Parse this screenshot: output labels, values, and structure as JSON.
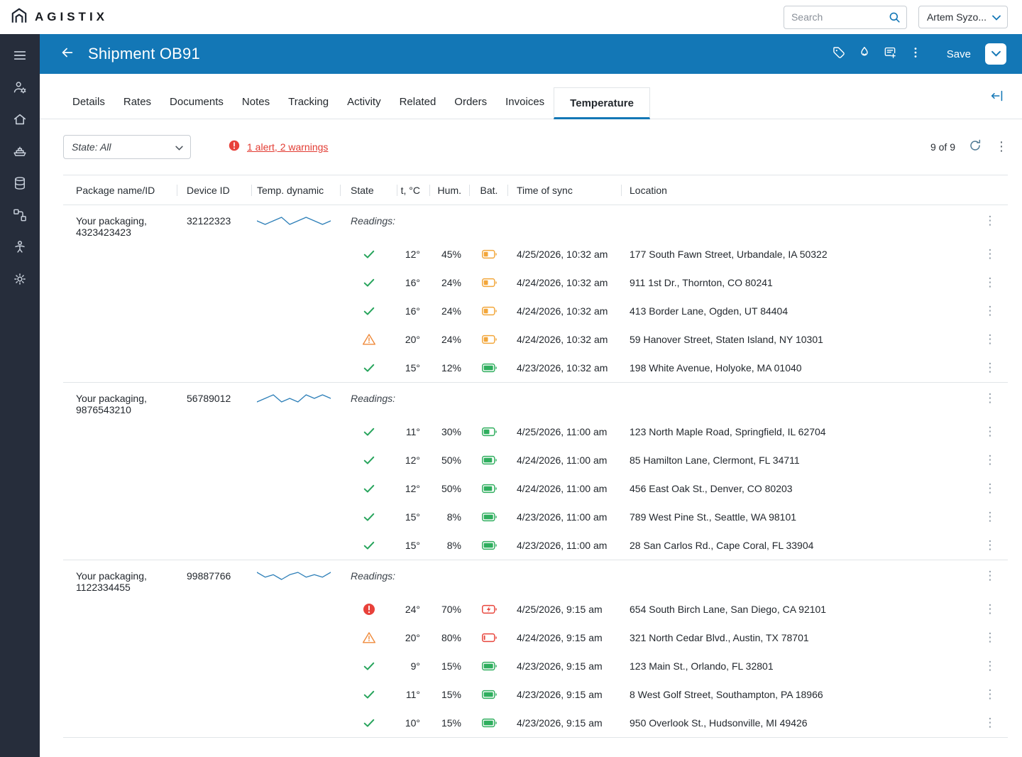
{
  "brand": {
    "name": "AGISTIX"
  },
  "topbar": {
    "search_placeholder": "Search",
    "user_menu_label": "Artem Syzo..."
  },
  "sidebar": {
    "items": [
      {
        "id": "menu"
      },
      {
        "id": "user-settings"
      },
      {
        "id": "home"
      },
      {
        "id": "ship"
      },
      {
        "id": "database"
      },
      {
        "id": "workflow"
      },
      {
        "id": "person"
      },
      {
        "id": "gear"
      }
    ]
  },
  "header": {
    "title": "Shipment OB91",
    "save_label": "Save",
    "actions": [
      {
        "id": "tag"
      },
      {
        "id": "flame"
      },
      {
        "id": "note-add"
      },
      {
        "id": "more"
      }
    ]
  },
  "tabs": [
    {
      "label": "Details"
    },
    {
      "label": "Rates"
    },
    {
      "label": "Documents"
    },
    {
      "label": "Notes"
    },
    {
      "label": "Tracking"
    },
    {
      "label": "Activity"
    },
    {
      "label": "Related"
    },
    {
      "label": "Orders"
    },
    {
      "label": "Invoices"
    },
    {
      "label": "Temperature",
      "active": true
    }
  ],
  "filterbar": {
    "state_filter": "State: All",
    "alerts_link": "1 alert, 2 warnings",
    "counter": "9 of 9"
  },
  "table": {
    "columns": [
      "Package name/ID",
      "Device ID",
      "Temp. dynamic",
      "State",
      "t, °C",
      "Hum.",
      "Bat.",
      "Time of sync",
      "Location"
    ],
    "readings_label": "Readings:",
    "groups": [
      {
        "package_name": "Your packaging,",
        "package_id": "4323423423",
        "device_id": "32122323",
        "sparkline": [
          6,
          5,
          6,
          7,
          5,
          6,
          7,
          6,
          5,
          6
        ],
        "readings": [
          {
            "state": "ok",
            "temp": "12°",
            "humidity": "45%",
            "battery": {
              "color": "yellow",
              "level": 0.45,
              "charging": false
            },
            "time": "4/25/2026, 10:32 am",
            "location": "177 South Fawn Street, Urbandale, IA 50322"
          },
          {
            "state": "ok",
            "temp": "16°",
            "humidity": "24%",
            "battery": {
              "color": "yellow",
              "level": 0.45,
              "charging": false
            },
            "time": "4/24/2026, 10:32 am",
            "location": "911 1st Dr., Thornton, CO 80241"
          },
          {
            "state": "ok",
            "temp": "16°",
            "humidity": "24%",
            "battery": {
              "color": "yellow",
              "level": 0.45,
              "charging": false
            },
            "time": "4/24/2026, 10:32 am",
            "location": "413 Border Lane, Ogden, UT 84404"
          },
          {
            "state": "warning",
            "temp": "20°",
            "humidity": "24%",
            "battery": {
              "color": "yellow",
              "level": 0.45,
              "charging": false
            },
            "time": "4/24/2026, 10:32 am",
            "location": "59 Hanover Street, Staten Island, NY 10301"
          },
          {
            "state": "ok",
            "temp": "15°",
            "humidity": "12%",
            "battery": {
              "color": "green",
              "level": 1,
              "charging": false
            },
            "time": "4/23/2026, 10:32 am",
            "location": "198 White Avenue, Holyoke, MA 01040"
          }
        ]
      },
      {
        "package_name": "Your packaging,",
        "package_id": "9876543210",
        "device_id": "56789012",
        "sparkline": [
          5,
          6,
          7,
          5,
          6,
          5,
          7,
          6,
          7,
          6
        ],
        "readings": [
          {
            "state": "ok",
            "temp": "11°",
            "humidity": "30%",
            "battery": {
              "color": "green",
              "level": 0.6,
              "charging": false
            },
            "time": "4/25/2026, 11:00 am",
            "location": "123 North Maple Road, Springfield, IL 62704"
          },
          {
            "state": "ok",
            "temp": "12°",
            "humidity": "50%",
            "battery": {
              "color": "green",
              "level": 0.9,
              "charging": false
            },
            "time": "4/24/2026, 11:00 am",
            "location": "85 Hamilton Lane, Clermont, FL 34711"
          },
          {
            "state": "ok",
            "temp": "12°",
            "humidity": "50%",
            "battery": {
              "color": "green",
              "level": 0.9,
              "charging": false
            },
            "time": "4/24/2026, 11:00 am",
            "location": "456 East Oak St., Denver, CO 80203"
          },
          {
            "state": "ok",
            "temp": "15°",
            "humidity": "8%",
            "battery": {
              "color": "green",
              "level": 1,
              "charging": false
            },
            "time": "4/23/2026, 11:00 am",
            "location": "789 West Pine St., Seattle, WA 98101"
          },
          {
            "state": "ok",
            "temp": "15°",
            "humidity": "8%",
            "battery": {
              "color": "green",
              "level": 1,
              "charging": false
            },
            "time": "4/23/2026, 11:00 am",
            "location": "28 San Carlos Rd., Cape Coral, FL 33904"
          }
        ]
      },
      {
        "package_name": "Your packaging,",
        "package_id": "1122334455",
        "device_id": "99887766",
        "sparkline": [
          7,
          5,
          6,
          4,
          6,
          7,
          5,
          6,
          5,
          7
        ],
        "readings": [
          {
            "state": "alert",
            "temp": "24°",
            "humidity": "70%",
            "battery": {
              "color": "red",
              "level": 0,
              "charging": true
            },
            "time": "4/25/2026, 9:15 am",
            "location": "654 South Birch Lane, San Diego, CA 92101"
          },
          {
            "state": "warning",
            "temp": "20°",
            "humidity": "80%",
            "battery": {
              "color": "red",
              "level": 0.15,
              "charging": false
            },
            "time": "4/24/2026, 9:15 am",
            "location": "321 North Cedar Blvd., Austin, TX 78701"
          },
          {
            "state": "ok",
            "temp": "9°",
            "humidity": "15%",
            "battery": {
              "color": "green",
              "level": 1,
              "charging": false
            },
            "time": "4/23/2026, 9:15 am",
            "location": "123 Main St., Orlando, FL 32801"
          },
          {
            "state": "ok",
            "temp": "11°",
            "humidity": "15%",
            "battery": {
              "color": "green",
              "level": 1,
              "charging": false
            },
            "time": "4/23/2026, 9:15 am",
            "location": "8 West Golf Street, Southampton, PA 18966"
          },
          {
            "state": "ok",
            "temp": "10°",
            "humidity": "15%",
            "battery": {
              "color": "green",
              "level": 1,
              "charging": false
            },
            "time": "4/23/2026, 9:15 am",
            "location": "950 Overlook St., Hudsonville, MI 49426"
          }
        ]
      }
    ]
  },
  "colors": {
    "accent": "#1377b6",
    "ok": "#27a45c",
    "warning": "#ef8a3b",
    "alert": "#e8413a",
    "battery_yellow": "#f2a63a",
    "battery_green": "#2fae5e",
    "battery_red": "#e8453c",
    "sidebar_bg": "#262d3b"
  }
}
